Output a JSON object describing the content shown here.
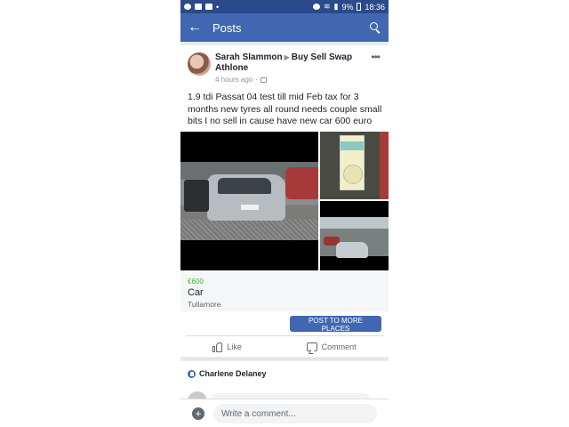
{
  "status_bar": {
    "battery": "9%",
    "time": "18:36"
  },
  "app_bar": {
    "title": "Posts"
  },
  "post": {
    "author": "Sarah Slammon",
    "group": "Buy Sell Swap Athlone",
    "time": "4 hours ago",
    "text": "1.9 tdi Passat 04 test till mid Feb tax for 3 months new tyres all round needs couple small bits I no sell in cause have new car 600 euro",
    "listing": {
      "price": "€600",
      "title": "Car",
      "location": "Tullamore"
    },
    "post_to_more_label": "POST TO MORE PLACES",
    "actions": {
      "like": "Like",
      "comment": "Comment"
    }
  },
  "likes": {
    "name": "Charlene Delaney"
  },
  "composer": {
    "placeholder": "Write a comment..."
  },
  "colors": {
    "brand": "#4267b2",
    "status_bar": "#2b4a8b",
    "price": "#42b72a"
  }
}
